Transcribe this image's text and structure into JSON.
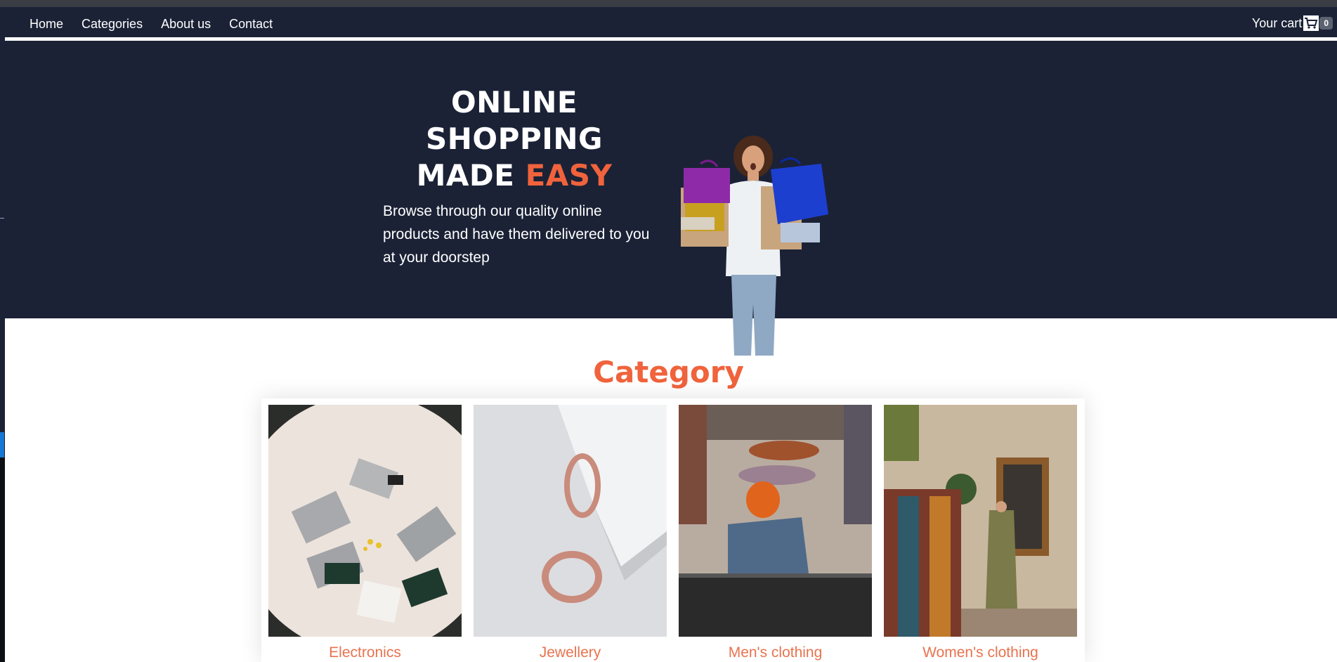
{
  "nav": {
    "links": [
      "Home",
      "Categories",
      "About us",
      "Contact"
    ],
    "cart_label": "Your cart",
    "cart_count": "0"
  },
  "hero": {
    "title_line1": "ONLINE",
    "title_line2": "SHOPPING",
    "title_line3_prefix": "MADE",
    "title_line3_accent": "EASY",
    "subtitle": "Browse through our quality online products and have them delivered to you at your doorstep"
  },
  "category": {
    "title": "Category",
    "items": [
      {
        "label": "Electronics"
      },
      {
        "label": "Jewellery"
      },
      {
        "label": "Men's clothing"
      },
      {
        "label": "Women's clothing"
      }
    ]
  },
  "colors": {
    "navy": "#1b2236",
    "accent": "#f0633c"
  }
}
